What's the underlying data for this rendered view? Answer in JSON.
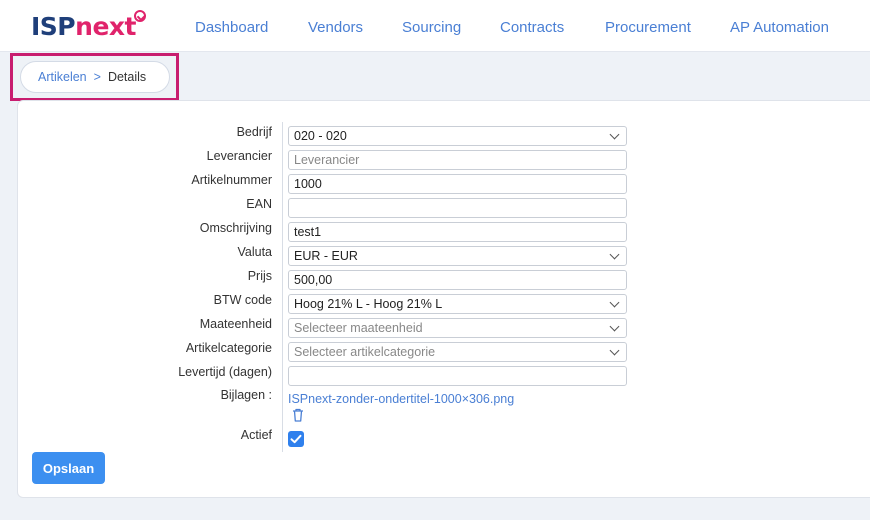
{
  "logo": {
    "part1": "ISP",
    "part2": "next"
  },
  "nav": [
    {
      "label": "Dashboard"
    },
    {
      "label": "Vendors"
    },
    {
      "label": "Sourcing"
    },
    {
      "label": "Contracts"
    },
    {
      "label": "Procurement"
    },
    {
      "label": "AP Automation"
    }
  ],
  "breadcrumb": {
    "parent": "Artikelen",
    "separator": ">",
    "current": "Details"
  },
  "form": {
    "bedrijf": {
      "label": "Bedrijf",
      "value": "020 - 020"
    },
    "leverancier": {
      "label": "Leverancier",
      "placeholder": "Leverancier"
    },
    "artikelnummer": {
      "label": "Artikelnummer",
      "value": "1000"
    },
    "ean": {
      "label": "EAN",
      "value": ""
    },
    "omschrijving": {
      "label": "Omschrijving",
      "value": "test1"
    },
    "valuta": {
      "label": "Valuta",
      "value": "EUR - EUR"
    },
    "prijs": {
      "label": "Prijs",
      "value": "500,00"
    },
    "btw_code": {
      "label": "BTW code",
      "value": "Hoog 21% L - Hoog 21% L"
    },
    "maateenheid": {
      "label": "Maateenheid",
      "placeholder": "Selecteer maateenheid"
    },
    "artikelcategorie": {
      "label": "Artikelcategorie",
      "placeholder": "Selecteer artikelcategorie"
    },
    "levertijd": {
      "label": "Levertijd (dagen)",
      "value": ""
    },
    "bijlagen": {
      "label": "Bijlagen :",
      "file": "ISPnext-zonder-ondertitel-1000×306.png"
    },
    "actief": {
      "label": "Actief",
      "checked": true
    }
  },
  "save_button": "Opslaan",
  "colors": {
    "accent": "#3c8ff0",
    "link": "#4a7fd4",
    "brand_dark": "#1f3f7a",
    "brand_pink": "#e0236b",
    "highlight": "#c81d6f"
  }
}
